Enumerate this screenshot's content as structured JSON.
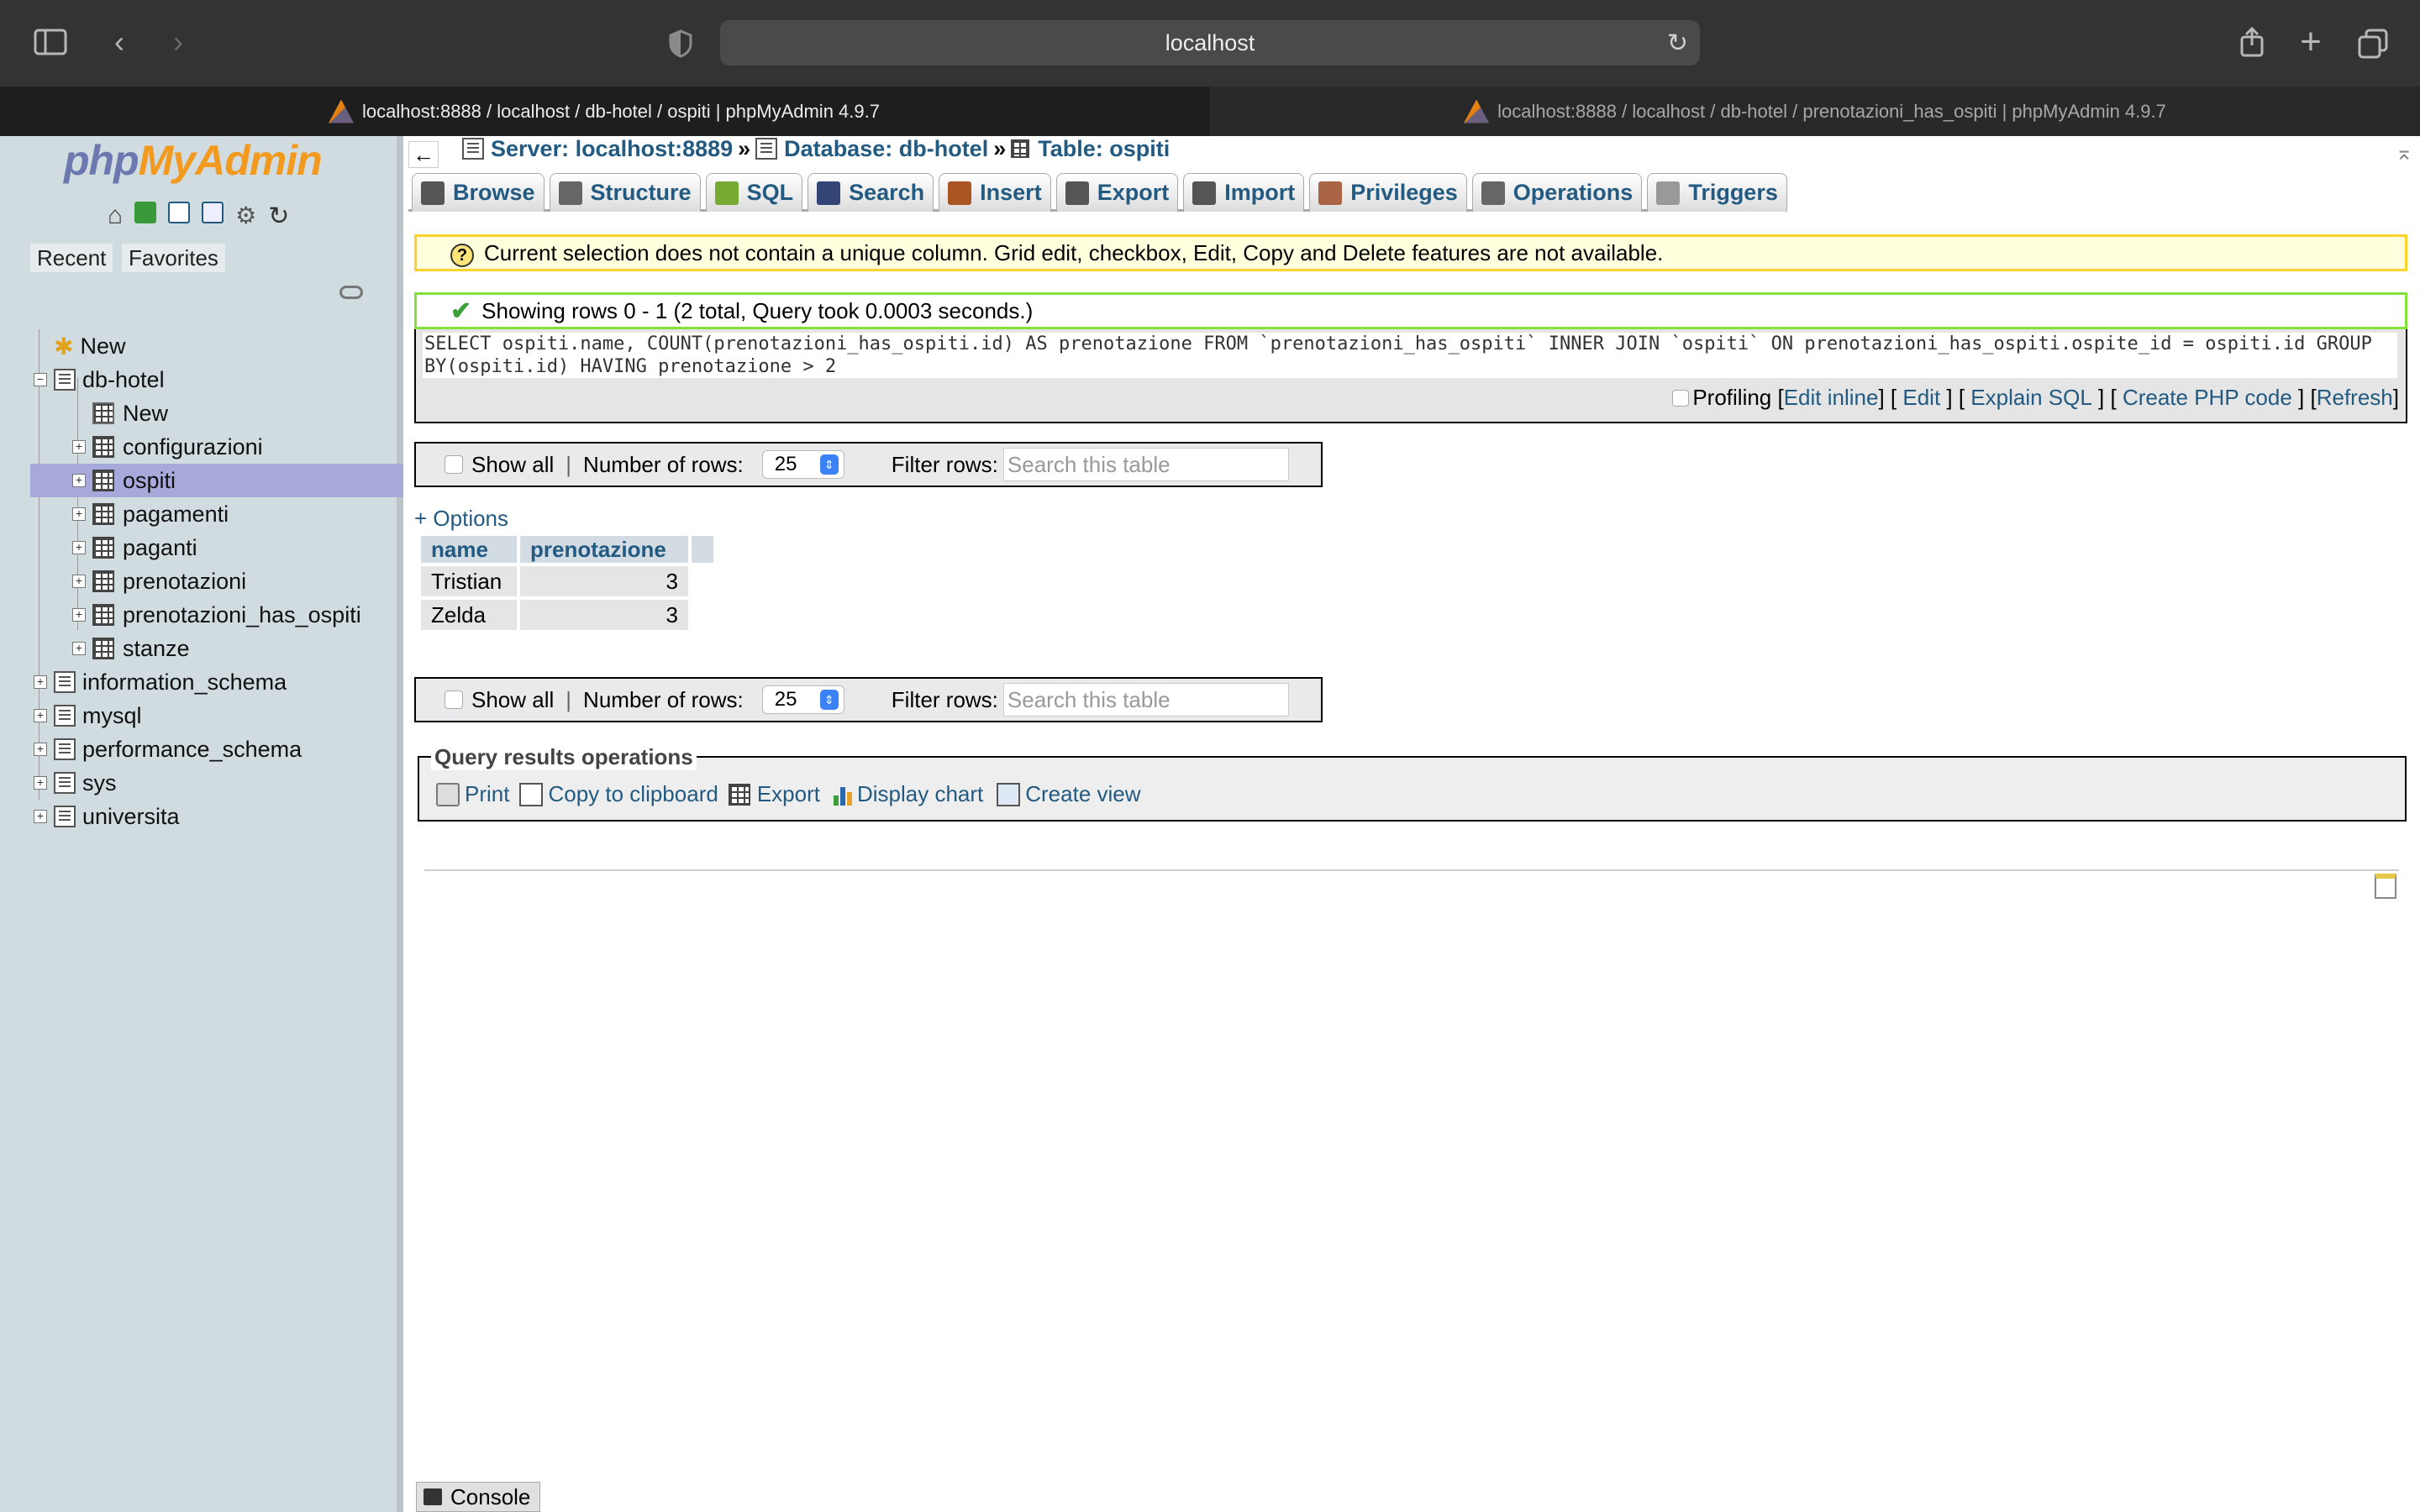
{
  "browser": {
    "url": "localhost",
    "tabs": [
      {
        "label": "localhost:8888 / localhost / db-hotel / ospiti | phpMyAdmin 4.9.7",
        "active": true
      },
      {
        "label": "localhost:8888 / localhost / db-hotel / prenotazioni_has_ospiti | phpMyAdmin 4.9.7",
        "active": false
      }
    ]
  },
  "sidebar": {
    "logo": {
      "php": "php",
      "my": "My",
      "admin": "Admin"
    },
    "tabs": [
      "Recent",
      "Favorites"
    ],
    "tree": [
      {
        "label": "New",
        "level": 0,
        "icon": "new-db-icon"
      },
      {
        "label": "db-hotel",
        "level": 0,
        "icon": "database-icon",
        "expanded": true
      },
      {
        "label": "New",
        "level": 1,
        "icon": "new-table-icon"
      },
      {
        "label": "configurazioni",
        "level": 1,
        "icon": "table-icon"
      },
      {
        "label": "ospiti",
        "level": 1,
        "icon": "table-icon",
        "selected": true
      },
      {
        "label": "pagamenti",
        "level": 1,
        "icon": "table-icon"
      },
      {
        "label": "paganti",
        "level": 1,
        "icon": "table-icon"
      },
      {
        "label": "prenotazioni",
        "level": 1,
        "icon": "table-icon"
      },
      {
        "label": "prenotazioni_has_ospiti",
        "level": 1,
        "icon": "table-icon"
      },
      {
        "label": "stanze",
        "level": 1,
        "icon": "table-icon"
      },
      {
        "label": "information_schema",
        "level": 0,
        "icon": "database-icon"
      },
      {
        "label": "mysql",
        "level": 0,
        "icon": "database-icon"
      },
      {
        "label": "performance_schema",
        "level": 0,
        "icon": "database-icon"
      },
      {
        "label": "sys",
        "level": 0,
        "icon": "database-icon"
      },
      {
        "label": "universita",
        "level": 0,
        "icon": "database-icon"
      }
    ]
  },
  "breadcrumb": {
    "server": "Server: localhost:8889",
    "database": "Database: db-hotel",
    "table": "Table: ospiti",
    "sep": "»"
  },
  "menu": [
    "Browse",
    "Structure",
    "SQL",
    "Search",
    "Insert",
    "Export",
    "Import",
    "Privileges",
    "Operations",
    "Triggers"
  ],
  "notice": "Current selection does not contain a unique column. Grid edit, checkbox, Edit, Copy and Delete features are not available.",
  "success": "Showing rows 0 - 1 (2 total, Query took 0.0003 seconds.)",
  "sql": {
    "line1": "SELECT ospiti.name, COUNT(prenotazioni_has_ospiti.id) AS prenotazione FROM `prenotazioni_has_ospiti` INNER JOIN `ospiti` ON prenotazioni_has_ospiti.ospite_id = ospiti.id GROUP",
    "line2": "BY(ospiti.id) HAVING prenotazione > 2",
    "profiling": "Profiling",
    "links": [
      "Edit inline",
      "Edit",
      "Explain SQL",
      "Create PHP code",
      "Refresh"
    ]
  },
  "nav": {
    "show_all": "Show all",
    "num_rows_label": "Number of rows:",
    "num_rows": "25",
    "filter_label": "Filter rows:",
    "filter_placeholder": "Search this table"
  },
  "options": "+ Options",
  "results": {
    "columns": [
      "name",
      "prenotazione"
    ],
    "rows": [
      [
        "Tristian",
        "3"
      ],
      [
        "Zelda",
        "3"
      ]
    ]
  },
  "qro": {
    "legend": "Query results operations",
    "links": [
      "Print",
      "Copy to clipboard",
      "Export",
      "Display chart",
      "Create view"
    ]
  },
  "console": "Console"
}
